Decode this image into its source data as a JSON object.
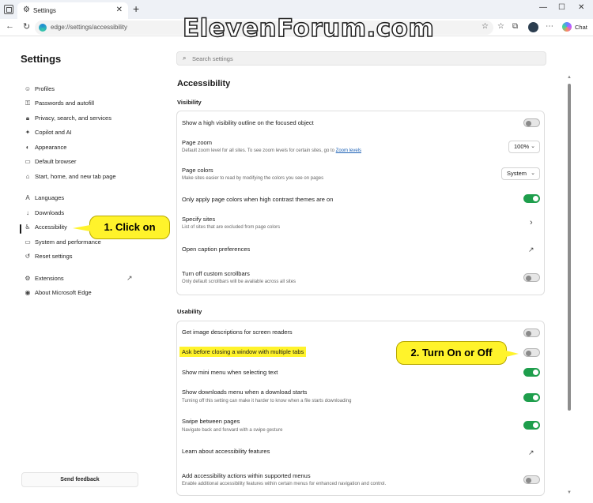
{
  "browser": {
    "tab_title": "Settings",
    "address_url": "edge://settings/accessibility",
    "chat_label": "Chat"
  },
  "watermark": "ElevenForum.com",
  "sidebar": {
    "title": "Settings",
    "items": [
      {
        "label": "Profiles",
        "icon": "profile-icon"
      },
      {
        "label": "Passwords and autofill",
        "icon": "key-icon"
      },
      {
        "label": "Privacy, search, and services",
        "icon": "lock-icon"
      },
      {
        "label": "Copilot and AI",
        "icon": "copilot-icon"
      },
      {
        "label": "Appearance",
        "icon": "appearance-icon"
      },
      {
        "label": "Default browser",
        "icon": "browser-icon"
      },
      {
        "label": "Start, home, and new tab page",
        "icon": "home-icon"
      },
      {
        "label": "Languages",
        "icon": "languages-icon"
      },
      {
        "label": "Downloads",
        "icon": "download-icon"
      },
      {
        "label": "Accessibility",
        "icon": "accessibility-icon"
      },
      {
        "label": "System and performance",
        "icon": "system-icon"
      },
      {
        "label": "Reset settings",
        "icon": "reset-icon"
      },
      {
        "label": "Extensions",
        "icon": "extensions-icon"
      },
      {
        "label": "About Microsoft Edge",
        "icon": "edge-icon"
      }
    ],
    "active_item": "Accessibility",
    "feedback_label": "Send feedback"
  },
  "search": {
    "placeholder": "Search settings"
  },
  "main": {
    "title": "Accessibility",
    "visibility": {
      "heading": "Visibility",
      "rows": [
        {
          "title": "Show a high visibility outline on the focused object",
          "toggle": "off"
        },
        {
          "title": "Page zoom",
          "subtitle_prefix": "Default zoom level for all sites. To see zoom levels for certain sites, go to ",
          "subtitle_link": "Zoom levels",
          "dropdown_value": "100%"
        },
        {
          "title": "Page colors",
          "subtitle": "Make sites easier to read by modifying the colors you see on pages",
          "dropdown_value": "System"
        },
        {
          "title": "Only apply page colors when high contrast themes are on",
          "toggle": "on"
        },
        {
          "title": "Specify sites",
          "subtitle": "List of sites that are excluded from page colors"
        },
        {
          "title": "Open caption preferences"
        },
        {
          "title": "Turn off custom scrollbars",
          "subtitle": "Only default scrollbars will be available across all sites",
          "toggle": "off"
        }
      ]
    },
    "usability": {
      "heading": "Usability",
      "rows": [
        {
          "title": "Get image descriptions for screen readers",
          "toggle": "off"
        },
        {
          "title": "Ask before closing a window with multiple tabs",
          "toggle": "off"
        },
        {
          "title": "Show mini menu when selecting text",
          "toggle": "on"
        },
        {
          "title": "Show downloads menu when a download starts",
          "subtitle": "Turning off this setting can make it harder to know when a file starts downloading",
          "toggle": "on"
        },
        {
          "title": "Swipe between pages",
          "subtitle": "Navigate back and forward with a swipe gesture",
          "toggle": "on"
        },
        {
          "title": "Learn about accessibility features"
        },
        {
          "title": "Add accessibility actions within supported menus",
          "subtitle": "Enable additional accessibility features within certain menus for enhanced navigation and control.",
          "toggle": "off"
        }
      ]
    }
  },
  "callouts": {
    "step1": "1. Click on",
    "step2": "2. Turn On or Off"
  },
  "colors": {
    "toggle_on": "#1e9e4c",
    "callout_yellow": "#fff32b",
    "link_blue": "#1a5fb4"
  }
}
